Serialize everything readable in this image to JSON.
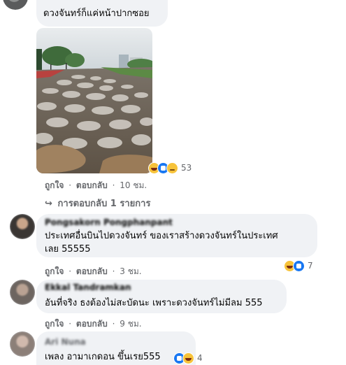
{
  "comments": [
    {
      "text": "ดวงจันทร์ก็แค่หน้าปากซอย",
      "actions": {
        "like": "ถูกใจ",
        "reply": "ตอบกลับ",
        "time": "10 ชม."
      },
      "reactions": {
        "icons": [
          "haha-icon",
          "like-icon",
          "sad-icon"
        ],
        "count": "53"
      },
      "replies_link": "การตอบกลับ 1 รายการ"
    },
    {
      "name": "Pongsakorn Pongphanpant",
      "lines": [
        "ประเทศอื่นบินไปดวงจันทร์ ของเราสร้างดวงจันทร์ในประเทศ",
        "เลย 55555"
      ],
      "actions": {
        "like": "ถูกใจ",
        "reply": "ตอบกลับ",
        "time": "3 ชม."
      },
      "reactions": {
        "icons": [
          "haha-icon",
          "like-icon"
        ],
        "count": "7"
      }
    },
    {
      "name": "Ekkal Tandramkan",
      "text": "อันที่จริง ธงต้องไม่สะบัดนะ เพราะดวงจันทร์ไม่มีลม 555",
      "actions": {
        "like": "ถูกใจ",
        "reply": "ตอบกลับ",
        "time": "9 ชม."
      }
    },
    {
      "name": "Ari Nuna",
      "text": "เพลง อามาเกดอน ขึ้นเรย555",
      "reactions": {
        "icons": [
          "like-icon",
          "haha-icon"
        ],
        "count": "4"
      }
    }
  ],
  "separator": "·",
  "colors": {
    "bubble": "#f0f2f5",
    "meta": "#65676b",
    "like_blue": "#1877f2",
    "haha_yellow": "#f7c33a"
  }
}
